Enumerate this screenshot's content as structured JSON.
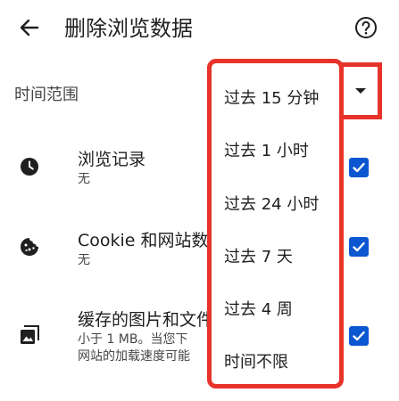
{
  "header": {
    "title": "删除浏览数据"
  },
  "time_range": {
    "label": "时间范围",
    "menu_items": [
      "过去 15 分钟",
      "过去 1 小时",
      "过去 24 小时",
      "过去 7 天",
      "过去 4 周",
      "时间不限"
    ],
    "selected": "过去 15 分钟"
  },
  "options": [
    {
      "title": "浏览记录",
      "desc_lines": [
        "无"
      ],
      "checked": true
    },
    {
      "title": "Cookie 和网站数",
      "desc_lines": [
        "无"
      ],
      "checked": true
    },
    {
      "title": "缓存的图片和文件",
      "desc_lines": [
        "小于 1 MB。当您下",
        "网站的加载速度可能"
      ],
      "checked": true
    }
  ],
  "colors": {
    "checkbox": "#0b57d0",
    "highlight": "#e8332a",
    "text": "#1f1f1f",
    "secondary_text": "#444746"
  },
  "icons": {
    "back": "arrow-left-icon",
    "help": "help-circle-icon",
    "history": "clock-icon",
    "cookies": "cookie-icon",
    "cache": "image-icon",
    "check": "checkmark-icon",
    "dropdown": "caret-down-icon"
  }
}
